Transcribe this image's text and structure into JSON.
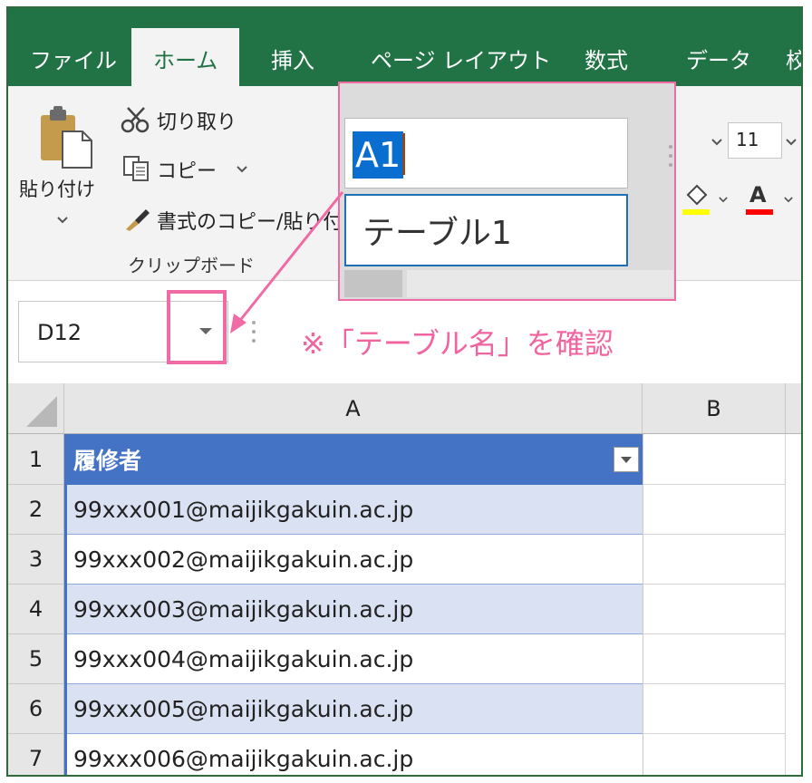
{
  "tabs": [
    {
      "label": "ファイル",
      "active": false
    },
    {
      "label": "ホーム",
      "active": true
    },
    {
      "label": "挿入",
      "active": false
    },
    {
      "label": "ページ レイアウト",
      "active": false
    },
    {
      "label": "数式",
      "active": false
    },
    {
      "label": "データ",
      "active": false
    },
    {
      "label": "校",
      "active": false
    }
  ],
  "clipboard": {
    "paste_label_line1": "貼り付け",
    "cut_label": "切り取り",
    "copy_label": "コピー",
    "format_painter_label": "書式のコピー/貼り付け",
    "group_label": "クリップボード"
  },
  "font": {
    "size": "11",
    "font_color_letter": "A"
  },
  "name_box": {
    "value": "D12"
  },
  "popup": {
    "input_value": "A1",
    "list_item": "テーブル1"
  },
  "callout": {
    "text": "※「テーブル名」を確認"
  },
  "columns": [
    "A",
    "B"
  ],
  "rows": [
    {
      "num": "1",
      "a": "履修者"
    },
    {
      "num": "2",
      "a": "99xxx001@maijikgakuin.ac.jp"
    },
    {
      "num": "3",
      "a": "99xxx002@maijikgakuin.ac.jp"
    },
    {
      "num": "4",
      "a": "99xxx003@maijikgakuin.ac.jp"
    },
    {
      "num": "5",
      "a": "99xxx004@maijikgakuin.ac.jp"
    },
    {
      "num": "6",
      "a": "99xxx005@maijikgakuin.ac.jp"
    },
    {
      "num": "7",
      "a": "99xxx006@maijikgakuin.ac.jp"
    }
  ],
  "colors": {
    "ribbon_green": "#217346",
    "table_header": "#4472c4",
    "table_band": "#d9e1f2",
    "highlight_pink": "#f06aa4",
    "selection_blue": "#0a6ed1"
  }
}
